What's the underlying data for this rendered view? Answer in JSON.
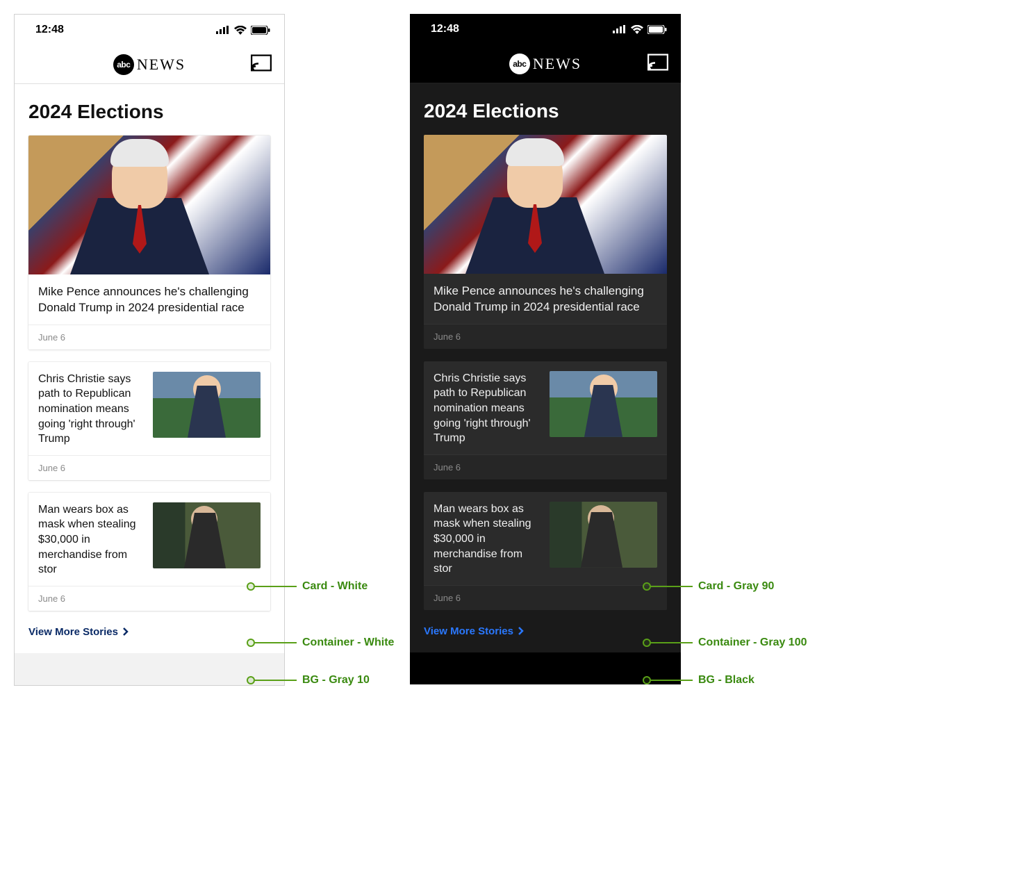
{
  "statusbar": {
    "time": "12:48"
  },
  "header": {
    "brand_small": "abc",
    "brand_large": "NEWS"
  },
  "section": {
    "title": "2024 Elections"
  },
  "stories": [
    {
      "headline": "Mike Pence announces he's challenging Donald Trump in 2024 presidential race",
      "date": "June 6"
    },
    {
      "headline": "Chris Christie says path to Republican nomination means going 'right through' Trump",
      "date": "June 6"
    },
    {
      "headline": "Man wears box as mask when stealing $30,000 in merchandise from stor",
      "date": "June 6"
    }
  ],
  "viewmore": {
    "label": "View More Stories"
  },
  "annotations": {
    "light": {
      "card": "Card - White",
      "container": "Container - White",
      "bg": "BG - Gray 10"
    },
    "dark": {
      "card": "Card - Gray 90",
      "container": "Container - Gray 100",
      "bg": "BG - Black"
    }
  }
}
